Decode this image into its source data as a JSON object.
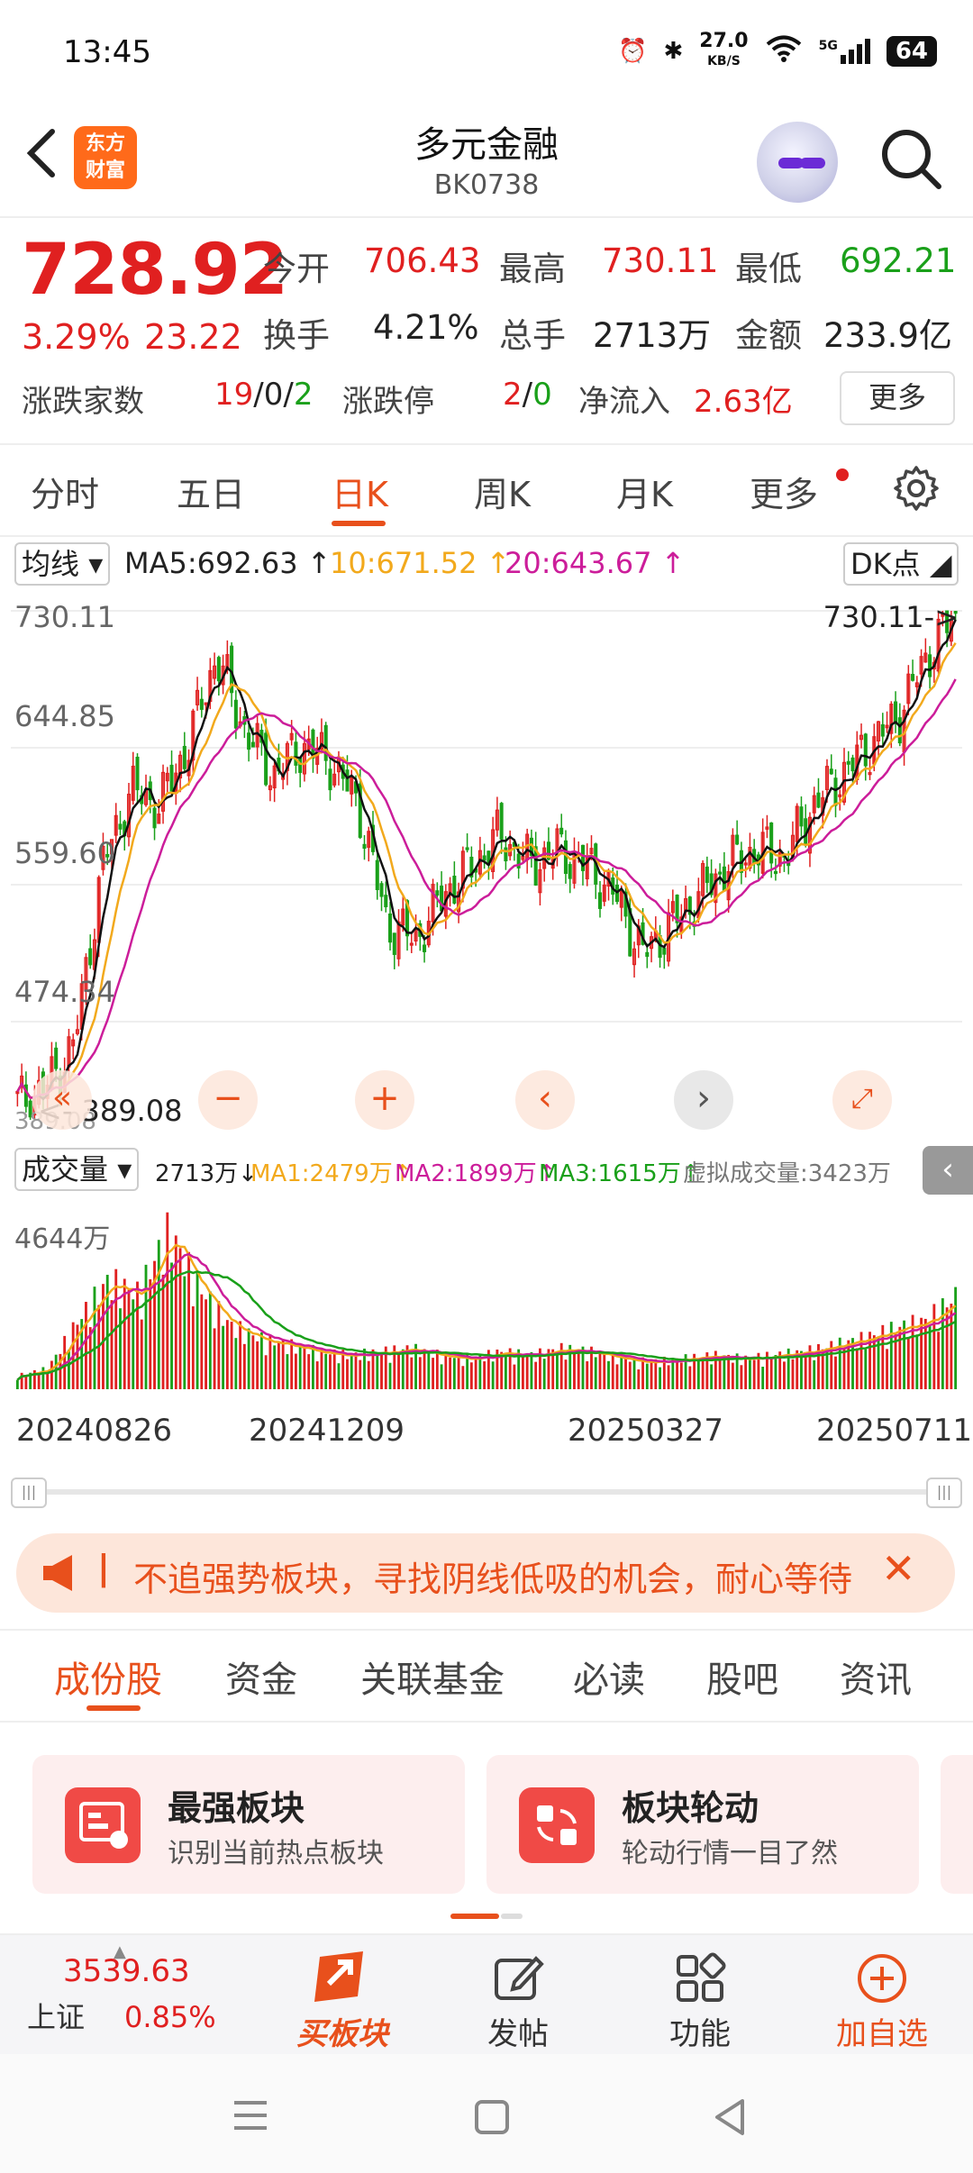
{
  "status": {
    "time": "13:45",
    "net_speed": "27.0",
    "net_unit": "KB/S",
    "signal": "5G",
    "battery": "64"
  },
  "header": {
    "logo_line1": "东方",
    "logo_line2": "财富",
    "title": "多元金融",
    "code": "BK0738"
  },
  "quote": {
    "price": "728.92",
    "change_pct": "3.29%",
    "change": "23.22",
    "open_label": "今开",
    "open": "706.43",
    "high_label": "最高",
    "high": "730.11",
    "low_label": "最低",
    "low": "692.21",
    "turnover_label": "换手",
    "turnover": "4.21%",
    "volume_label": "总手",
    "volume": "2713万",
    "amount_label": "金额",
    "amount": "233.9亿",
    "breadth_label": "涨跌家数",
    "breadth_up": "19",
    "breadth_flat": "0",
    "breadth_down": "2",
    "sep": "/",
    "limit_label": "涨跌停",
    "limit_up": "2",
    "limit_down": "0",
    "inflow_label": "净流入",
    "inflow": "2.63亿",
    "more": "更多"
  },
  "tabs": [
    "分时",
    "五日",
    "日K",
    "周K",
    "月K",
    "更多"
  ],
  "ma_bar": {
    "select": "均线",
    "ma5": "MA5:692.63",
    "ma10": "10:671.52",
    "ma20": "20:643.67",
    "dk": "DK点"
  },
  "chart": {
    "y_labels": [
      "730.11",
      "644.85",
      "559.60",
      "474.34",
      "389.08"
    ],
    "hi_annot": "730.11->",
    "lo_annot": "389.08",
    "lo_y": "389.08"
  },
  "vol_bar": {
    "select": "成交量",
    "vol": "2713万",
    "ma1": "MA1:2479万",
    "ma2": "MA2:1899万",
    "ma3": "MA3:1615万",
    "virtual": "虚拟成交量:3423万",
    "y_label": "4644万"
  },
  "dates": [
    "20240826",
    "20241209",
    "20250327",
    "20250711"
  ],
  "banner": {
    "text": "不追强势板块，寻找阴线低吸的机会，耐心等待"
  },
  "subtabs": [
    "成份股",
    "资金",
    "关联基金",
    "必读",
    "股吧",
    "资讯"
  ],
  "cards": [
    {
      "title": "最强板块",
      "sub": "识别当前热点板块"
    },
    {
      "title": "板块轮动",
      "sub": "轮动行情一目了然"
    }
  ],
  "bottom_nav": {
    "index_value": "3539.63",
    "index_name": "上证",
    "index_pct": "0.85%",
    "buy": "买板块",
    "post": "发帖",
    "func": "功能",
    "add": "加自选"
  },
  "colors": {
    "up": "#e02020",
    "down": "#1aa01a",
    "accent": "#e8501c",
    "ma5": "#111111",
    "ma10": "#f2a91c",
    "ma20": "#cc1d9a"
  },
  "chart_data": {
    "type": "candlestick",
    "ylim": [
      389.08,
      730.11
    ],
    "x": [
      "20240826",
      "20241209",
      "20250327",
      "20250711"
    ],
    "close_trend": [
      400,
      410,
      440,
      560,
      610,
      600,
      640,
      700,
      650,
      620,
      640,
      630,
      600,
      520,
      510,
      540,
      560,
      580,
      560,
      570,
      560,
      540,
      500,
      520,
      540,
      560,
      570,
      565,
      600,
      620,
      640,
      660,
      700,
      729
    ],
    "volume_trend": [
      400,
      600,
      2000,
      3200,
      2800,
      4644,
      3000,
      1900,
      1500,
      1300,
      1100,
      1000,
      1100,
      1200,
      1000,
      900,
      1100,
      1000,
      1200,
      1100,
      900,
      800,
      900,
      1000,
      900,
      1000,
      1100,
      1300,
      1500,
      1800,
      2000,
      2713
    ]
  }
}
